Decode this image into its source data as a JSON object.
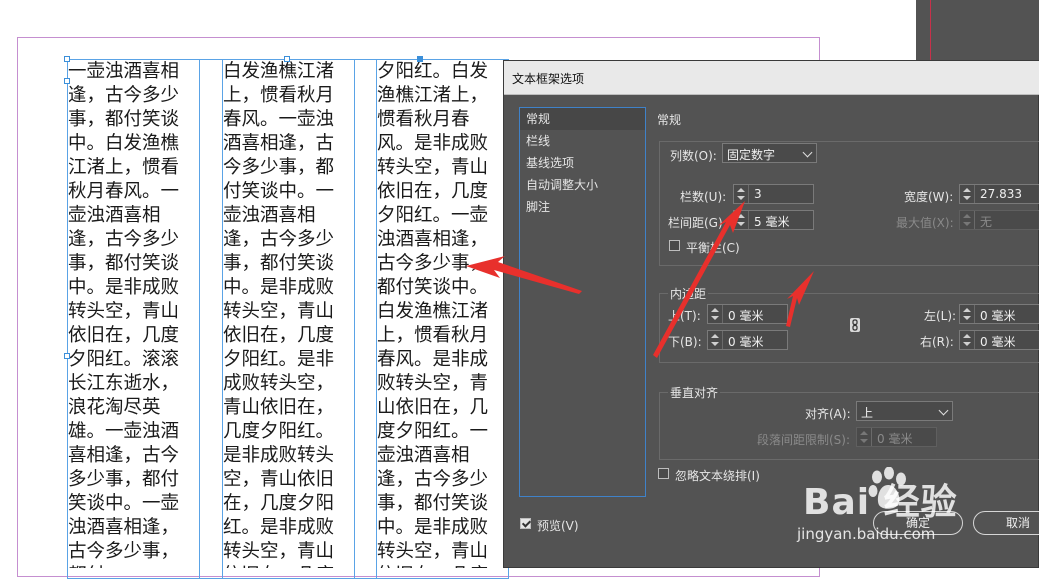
{
  "document": {
    "columns": [
      "一壶浊酒喜相逢，古今多少事，都付笑谈中。白发渔樵江渚上，惯看秋月春风。一壶浊酒喜相逢，古今多少事，都付笑谈中。是非成败转头空，青山依旧在，几度夕阳红。滚滚长江东逝水，浪花淘尽英雄。一壶浊酒喜相逢，古今多少事，都付笑谈中。一壶浊酒喜相逢，古今多少事，都付",
      "白发渔樵江渚上，惯看秋月春风。一壶浊酒喜相逢，古今多少事，都付笑谈中。一壶浊酒喜相逢，古今多少事，都付笑谈中。是非成败转头空，青山依旧在，几度夕阳红。是非成败转头空，青山依旧在，几度夕阳红。是非成败转头空，青山依旧在，几度夕阳红。是非成败转头空，青山依旧在，几度夕阳",
      "夕阳红。白发渔樵江渚上，惯看秋月春风。是非成败转头空，青山依旧在，几度夕阳红。一壶浊酒喜相逢，古今多少事，都付笑谈中。白发渔樵江渚上，惯看秋月春风。是非成败转头空，青山依旧在，几度夕阳红。一壶浊酒喜相逢，古今多少事，都付笑谈中。是非成败转头空，青山依旧在，几度"
    ]
  },
  "dialog": {
    "title": "文本框架选项",
    "categories": [
      "常规",
      "栏线",
      "基线选项",
      "自动调整大小",
      "脚注"
    ],
    "selected_category": "常规",
    "section_title": "常规",
    "columns_group": {
      "type_label": "列数(O):",
      "type_value": "固定数字",
      "count_label": "栏数(U):",
      "count_value": "3",
      "gutter_label": "栏间距(G):",
      "gutter_value": "5 毫米",
      "width_label": "宽度(W):",
      "width_value": "27.833",
      "max_label": "最大值(X):",
      "max_value": "无",
      "balance_label": "平衡栏(C)"
    },
    "inset_group": {
      "title": "内边距",
      "top_label": "上(T):",
      "top_value": "0 毫米",
      "bottom_label": "下(B):",
      "bottom_value": "0 毫米",
      "left_label": "左(L):",
      "left_value": "0 毫米",
      "right_label": "右(R):",
      "right_value": "0 毫米"
    },
    "vertical_group": {
      "title": "垂直对齐",
      "align_label": "对齐(A):",
      "align_value": "上",
      "limit_label": "段落间距限制(S):",
      "limit_value": "0 毫米"
    },
    "ignore_wrap_label": "忽略文本绕排(I)",
    "preview_label": "预览(V)",
    "ok_label": "确定",
    "cancel_label": "取消"
  },
  "watermark": {
    "brand": "Bai  经验",
    "url": "jingyan.baidu.com"
  },
  "colors": {
    "dialog_bg": "#535353",
    "frame_guide": "#5aa3e6",
    "page_border": "#c58fd0",
    "arrow": "#e8302c"
  }
}
